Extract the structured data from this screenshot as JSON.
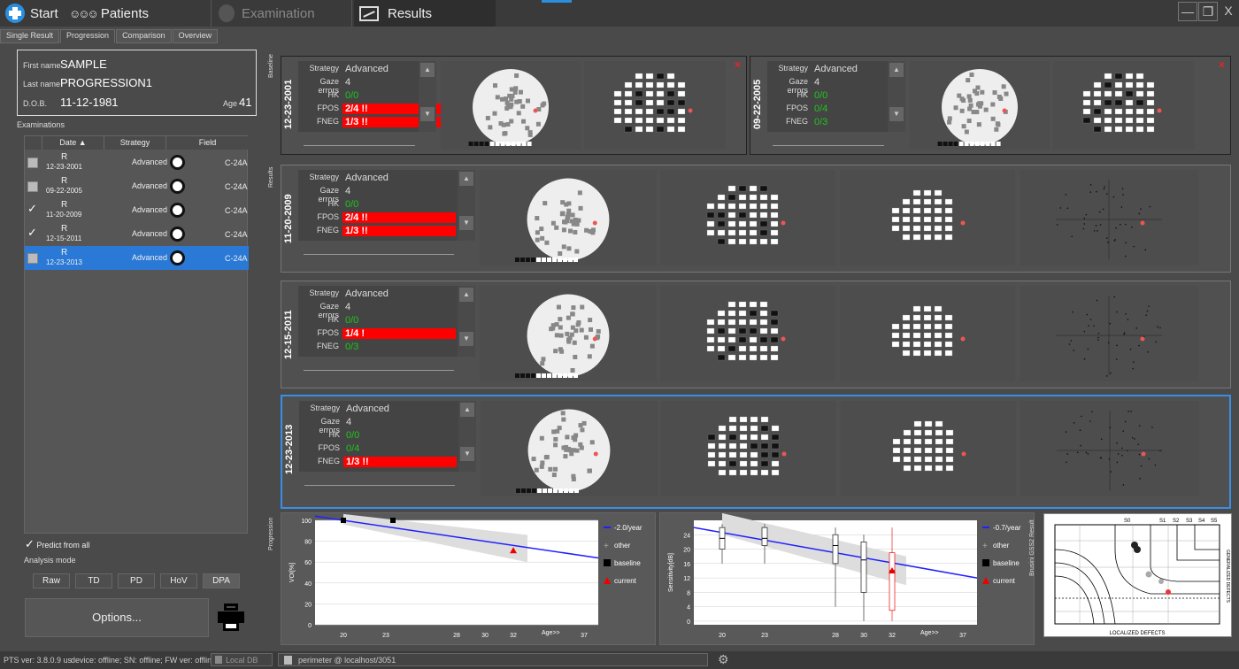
{
  "topbar": {
    "tabs": [
      {
        "label": "Start",
        "icon": "app-logo-icon"
      },
      {
        "label": "Patients",
        "icon": "people-icon"
      },
      {
        "label": "Examination",
        "icon": "head-icon"
      },
      {
        "label": "Results",
        "icon": "chart-icon"
      }
    ],
    "window_controls": {
      "minimize": "—",
      "restore": "❐",
      "close": "X"
    }
  },
  "subtabs": [
    "Single Result",
    "Progression",
    "Comparison",
    "Overview"
  ],
  "patient": {
    "first_name_label": "First name",
    "first_name": "SAMPLE",
    "last_name_label": "Last name",
    "last_name": "PROGRESSION1",
    "dob_label": "D.O.B.",
    "dob": "11-12-1981",
    "age_label": "Age",
    "age": "41"
  },
  "examinations": {
    "title": "Examinations",
    "columns": [
      "Date",
      "Strategy",
      "Field"
    ],
    "rows": [
      {
        "eye": "R",
        "date": "12-23-2001",
        "strategy": "Advanced",
        "field": "C-24A",
        "checked": false,
        "selected": false
      },
      {
        "eye": "R",
        "date": "09-22-2005",
        "strategy": "Advanced",
        "field": "C-24A",
        "checked": false,
        "selected": false
      },
      {
        "eye": "R",
        "date": "11-20-2009",
        "strategy": "Advanced",
        "field": "C-24A",
        "checked": true,
        "selected": false
      },
      {
        "eye": "R",
        "date": "12-15-2011",
        "strategy": "Advanced",
        "field": "C-24A",
        "checked": true,
        "selected": false
      },
      {
        "eye": "R",
        "date": "12-23-2013",
        "strategy": "Advanced",
        "field": "C-24A",
        "checked": false,
        "selected": true
      }
    ]
  },
  "predict": {
    "label": "Predict from all",
    "checked": true
  },
  "analysis_mode": {
    "label": "Analysis mode",
    "buttons": [
      "Raw",
      "TD",
      "PD",
      "HoV",
      "DPA"
    ]
  },
  "options_label": "Options...",
  "sections": {
    "baseline": "Baseline",
    "results": "Results",
    "progression": "Progression"
  },
  "baseline": [
    {
      "date": "12-23-2001",
      "strategy": "Advanced",
      "gaze": "4",
      "hk": "0/0",
      "fpos": "2/4 !!",
      "fneg": "1/3 !!",
      "fpos_bad": true,
      "fneg_bad": true
    },
    {
      "date": "09-22-2005",
      "strategy": "Advanced",
      "gaze": "4",
      "hk": "0/0",
      "fpos": "0/4",
      "fneg": "0/3",
      "fpos_bad": false,
      "fneg_bad": false
    }
  ],
  "results": [
    {
      "date": "11-20-2009",
      "strategy": "Advanced",
      "gaze": "4",
      "hk": "0/0",
      "fpos": "2/4 !!",
      "fneg": "1/3 !!",
      "fpos_bad": true,
      "fneg_bad": true,
      "selected": false
    },
    {
      "date": "12-15-2011",
      "strategy": "Advanced",
      "gaze": "4",
      "hk": "0/0",
      "fpos": "1/4 !",
      "fneg": "0/3",
      "fpos_bad": true,
      "fneg_bad": false,
      "selected": false
    },
    {
      "date": "12-23-2013",
      "strategy": "Advanced",
      "gaze": "4",
      "hk": "0/0",
      "fpos": "0/4",
      "fneg": "1/3 !!",
      "fpos_bad": false,
      "fneg_bad": true,
      "selected": true
    }
  ],
  "info_labels": {
    "strategy": "Strategy",
    "gaze": "Gaze errors",
    "hk": "HK",
    "fpos": "FPOS",
    "fneg": "FNEG"
  },
  "chart_data": [
    {
      "type": "line",
      "ylabel": "VOI[%]",
      "xlabel": "Age>>",
      "x_ticks": [
        "20",
        "23",
        "28",
        "30",
        "32",
        "37"
      ],
      "y_ticks": [
        "0",
        "20",
        "40",
        "60",
        "80",
        "100"
      ],
      "xlim": [
        18,
        38
      ],
      "ylim": [
        0,
        100
      ],
      "trend_label": "-2.0/year",
      "trend": {
        "x": [
          18,
          38
        ],
        "y": [
          104,
          64
        ]
      },
      "baseline_points": {
        "x": [
          20,
          23.5
        ],
        "y": [
          100,
          100
        ]
      },
      "current_points": {
        "x": [
          32
        ],
        "y": [
          71
        ]
      },
      "legend": [
        "-2.0/year",
        "other",
        "baseline",
        "current"
      ],
      "legend_colors": [
        "#2020ff",
        "#aaaaaa",
        "#000000",
        "#ff0000"
      ]
    },
    {
      "type": "line",
      "ylabel": "Sensitivity[dB]",
      "xlabel": "Age>>",
      "x_ticks": [
        "20",
        "23",
        "28",
        "30",
        "32",
        "37"
      ],
      "y_ticks": [
        "0",
        "4",
        "8",
        "12",
        "16",
        "20",
        "24"
      ],
      "xlim": [
        18,
        38
      ],
      "ylim": [
        -1,
        28
      ],
      "trend_label": "-0.7/year",
      "trend": {
        "x": [
          18,
          38
        ],
        "y": [
          26,
          12
        ]
      },
      "boxes": [
        {
          "x": 20,
          "median": 23,
          "q1": 20,
          "q3": 26,
          "min": 16,
          "max": 27
        },
        {
          "x": 23,
          "median": 23,
          "q1": 21,
          "q3": 26,
          "min": 16,
          "max": 27
        },
        {
          "x": 28,
          "median": 21,
          "q1": 16,
          "q3": 24,
          "min": 4,
          "max": 26
        },
        {
          "x": 30,
          "median": 17,
          "q1": 8,
          "q3": 22,
          "min": 0,
          "max": 24
        },
        {
          "x": 32,
          "median": 14,
          "q1": 3,
          "q3": 19,
          "min": 0,
          "max": 26
        }
      ],
      "current_points": {
        "x": [
          32
        ],
        "y": [
          14
        ]
      },
      "legend": [
        "-0.7/year",
        "other",
        "baseline",
        "current"
      ],
      "legend_colors": [
        "#2020ff",
        "#aaaaaa",
        "#000000",
        "#ff0000"
      ]
    }
  ],
  "gss2": {
    "title": "Brusini GSS2 Result",
    "bottom": "LOCALIZED DEFECTS",
    "right": "GENERALIZED DEFECTS",
    "codes": [
      "S0",
      "S1",
      "S2",
      "S3",
      "S4",
      "S5"
    ]
  },
  "status": {
    "version": "PTS ver: 3.8.0.9 us",
    "device": "device: offline; SN: offline; FW ver: offline",
    "db": "Local DB",
    "server": "perimeter @ localhost/3051"
  }
}
